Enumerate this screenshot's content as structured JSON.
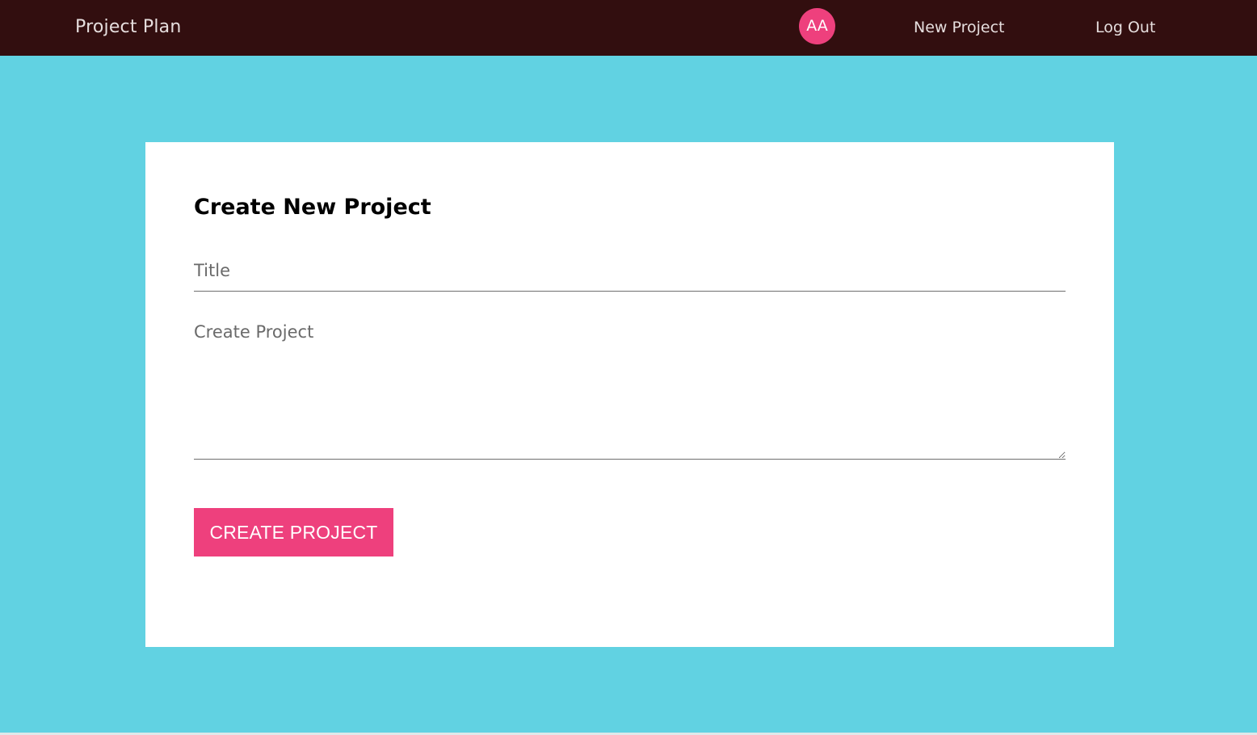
{
  "navbar": {
    "brand": "Project Plan",
    "avatar_initials": "AA",
    "links": {
      "new_project": "New Project",
      "log_out": "Log Out"
    }
  },
  "form": {
    "heading": "Create New Project",
    "title_field": {
      "placeholder": "Title",
      "value": ""
    },
    "content_field": {
      "placeholder": "Create Project",
      "value": ""
    },
    "submit_label": "CREATE PROJECT"
  },
  "colors": {
    "navbar_bg": "#320e0f",
    "page_bg": "#61d2e2",
    "accent": "#ee407d",
    "card_bg": "#ffffff"
  }
}
